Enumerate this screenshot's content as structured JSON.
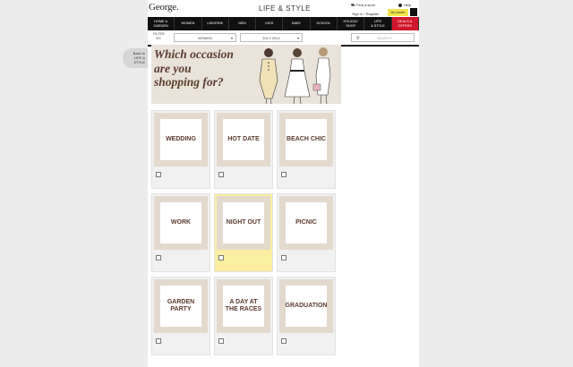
{
  "header": {
    "logo": "George.",
    "site_title": "LIFE & STYLE",
    "store_finder": "Find a store",
    "help": "Help",
    "sign_in": "Sign in / Register",
    "basket": "My basket"
  },
  "nav": [
    {
      "label": "HOME &\nGARDEN"
    },
    {
      "label": "WOMEN"
    },
    {
      "label": "LINGERIE"
    },
    {
      "label": "MEN"
    },
    {
      "label": "KIDS"
    },
    {
      "label": "BABY"
    },
    {
      "label": "SCHOOL"
    },
    {
      "label": "HOLIDAY\nSHOP"
    },
    {
      "label": "LIFE\n& STYLE"
    },
    {
      "label": "DEALS &\nOFFERS",
      "highlight": true
    }
  ],
  "filter": {
    "label": "FILTER\nBY:",
    "category": "WOMEN",
    "month": "JULY 2014",
    "search_placeholder": "SEARCH"
  },
  "back_link": "Back to\nLIFE &\nSTYLE",
  "banner": {
    "headline": "Which occasion\nare you\nshopping for?"
  },
  "occasions": [
    {
      "label": "WEDDING",
      "selected": false
    },
    {
      "label": "HOT DATE",
      "selected": false
    },
    {
      "label": "BEACH CHIC",
      "selected": false
    },
    {
      "label": "WORK",
      "selected": false
    },
    {
      "label": "NIGHT OUT",
      "selected": true
    },
    {
      "label": "PICNIC",
      "selected": false
    },
    {
      "label": "GARDEN\nPARTY",
      "selected": false
    },
    {
      "label": "A DAY AT\nTHE RACES",
      "selected": false
    },
    {
      "label": "GRADUATION",
      "selected": false
    }
  ],
  "colors": {
    "accent_sale": "#d0162c",
    "basket": "#f3e64b",
    "selected_tile": "#fbeea0",
    "label_brown": "#5a3a2e"
  }
}
